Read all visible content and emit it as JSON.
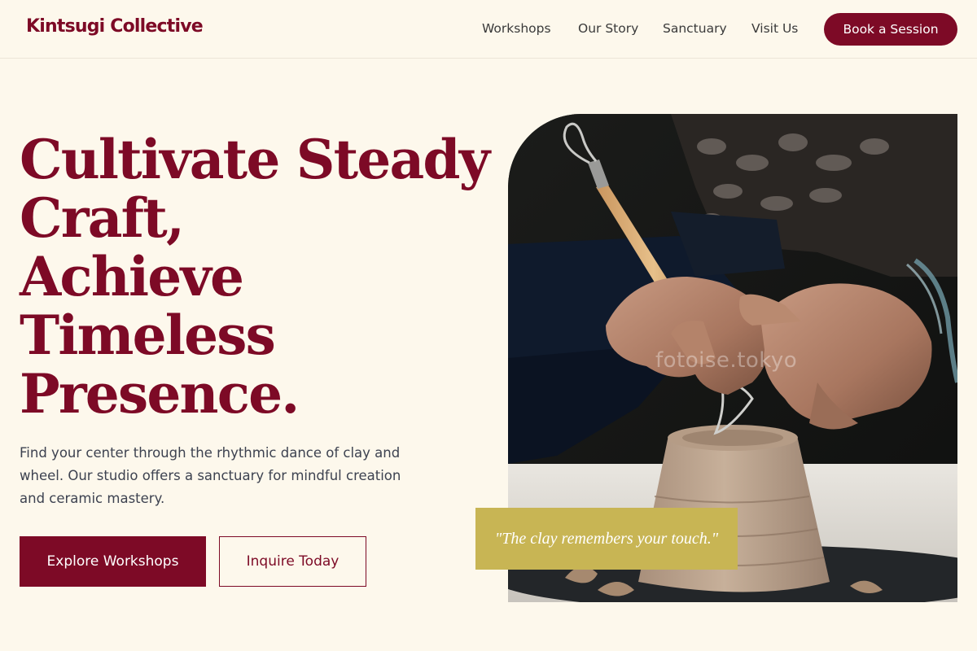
{
  "brand": {
    "name": "Kintsugi Collective"
  },
  "nav": {
    "items": [
      "Workshops",
      "Our Story",
      "Sanctuary",
      "Visit Us"
    ],
    "cta_label": "Book a Session"
  },
  "hero": {
    "headline_lines": [
      "Cultivate Steady",
      "Craft,",
      "Achieve",
      "Timeless",
      "Presence."
    ],
    "description": "Find your center through the rhythmic dance of clay and wheel. Our studio offers a sanctuary for mindful creation and ceramic mastery.",
    "primary_cta": "Explore Workshops",
    "secondary_cta": "Inquire Today",
    "quote": "\"The clay remembers your touch.\"",
    "image_watermark": "fotoise.tokyo"
  },
  "colors": {
    "brand": "#7d0a26",
    "background": "#fdf8ec",
    "quote_box": "#c8b554",
    "body_text": "#3d4250"
  },
  "image": {
    "subject": "hands shaping a clay pot with a loop trimming tool on a potter's wheel"
  }
}
